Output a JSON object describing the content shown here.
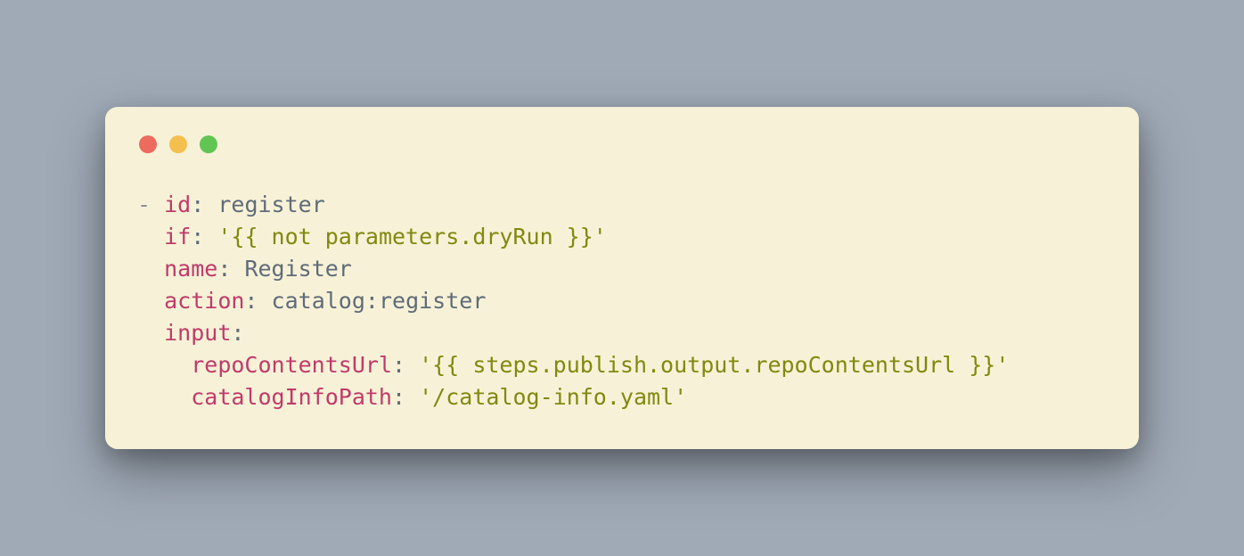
{
  "code": {
    "dash": "- ",
    "indent1": "  ",
    "indent2": "    ",
    "colon": ":",
    "space": " ",
    "keys": {
      "id": "id",
      "if": "if",
      "name": "name",
      "action": "action",
      "input": "input",
      "repoContentsUrl": "repoContentsUrl",
      "catalogInfoPath": "catalogInfoPath"
    },
    "values": {
      "id": "register",
      "if": "'{{ not parameters.dryRun }}'",
      "name": "Register",
      "action_ns": "catalog",
      "action_name": "register",
      "repoContentsUrl": "'{{ steps.publish.output.repoContentsUrl }}'",
      "catalogInfoPath": "'/catalog-info.yaml'"
    }
  },
  "colors": {
    "background": "#a0aab7",
    "window": "#f7f2d7",
    "key": "#c03a6b",
    "value": "#5f6b79",
    "string": "#82880f",
    "traffic_red": "#ec6a5e",
    "traffic_yellow": "#f4bf4f",
    "traffic_green": "#61c554"
  }
}
